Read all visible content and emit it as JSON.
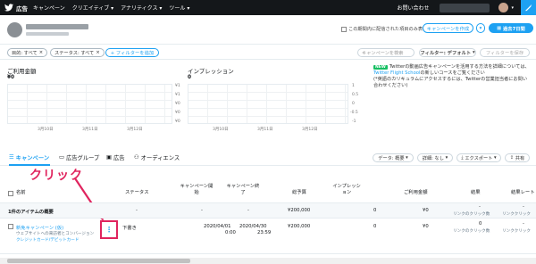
{
  "nav": {
    "brand": "広告",
    "menu": [
      "キャンペーン",
      "クリエイティブ",
      "アナリティクス",
      "ツール"
    ],
    "help": "お問い合わせ"
  },
  "account": {
    "checkbox_label": "この期間内に配信された項目のみ表示",
    "create_campaign": "キャンペーンを作成",
    "dropdown_caret": "▾",
    "ad_group_button": "過去7日間"
  },
  "filters": {
    "chips": [
      "目的: すべて",
      "ステータス: すべて"
    ],
    "add_filter": "+ フィルターを追加",
    "search_placeholder": "キャンペーンを検索",
    "filter_default": "フィルター: デフォルト",
    "save_filter": "フィルターを保存"
  },
  "charts": {
    "spend_label": "ご利用金額",
    "spend_value": "¥0",
    "impressions_label": "インプレッション",
    "impressions_value": "0",
    "right_ticks_1": [
      "¥1",
      "¥1",
      "¥0",
      "¥0",
      "¥0"
    ],
    "right_ticks_2": [
      "1",
      "0.5",
      "0",
      "-0.5",
      "-1"
    ],
    "x_ticks": [
      "3月10日",
      "3月11日",
      "3月12日"
    ]
  },
  "promo": {
    "badge": "NEW",
    "text1": "Twitterの動画広告キャンペーンを活用する方法を詳細については、",
    "link": "Twitter Flight School",
    "text2": "の新しいコースをご覧ください",
    "text3": "(*英語のカリキュラムにアクセスするには、Twitterの営業担当者にお問い合わせください)"
  },
  "tabs": {
    "campaigns": "キャンペーン",
    "ad_groups": "広告グループ",
    "ads": "広告",
    "audiences": "オーディエンス"
  },
  "table_buttons": {
    "data": "データ: 概要",
    "breakdown": "詳細: なし",
    "export": "エクスポート",
    "share": "共有"
  },
  "callout": "クリック",
  "table": {
    "headers": {
      "name": "名前",
      "status": "ステータス",
      "start": "キャンペーン開始",
      "end": "キャンペーン終了",
      "budget": "総予算",
      "impressions": "インプレッション",
      "spend": "ご利用金額",
      "result": "結果",
      "cost_per_result": "結果レート"
    },
    "summary_row": {
      "name": "1件のアイテムの概要",
      "status": "-",
      "start": "-",
      "end": "-",
      "budget": "¥200,000",
      "impressions": "0",
      "spend": "¥0",
      "result": "-",
      "result_sub": "リンクのクリック数",
      "cost": "-",
      "cost_sub": "リンククリック"
    },
    "row": {
      "name": "新免キャンペーン (仮)",
      "sub1": "ウェブサイトへの来訪者とコンバージョン",
      "sub2": "クレジットカード/デビットカード",
      "menu": "⋮",
      "status": "下書き",
      "start_date": "2020/04/01",
      "start_time": "0:00",
      "end_date": "2020/04/30",
      "end_time": "23:59",
      "budget": "¥200,000",
      "impressions": "0",
      "spend": "¥0",
      "result": "0",
      "result_sub": "リンクのクリック数",
      "cost": "-",
      "cost_sub": "リンククリック"
    }
  }
}
